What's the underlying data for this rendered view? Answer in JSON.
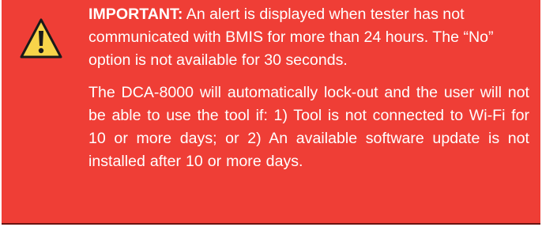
{
  "alert": {
    "icon": "warning-triangle-icon",
    "background_color": "#ef3e36",
    "text_color": "#ffffff",
    "lead": "IMPORTANT:",
    "paragraph1": "An alert is displayed when tester has not communicated with BMIS for more than 24 hours. The “No” option is not available for 30 seconds.",
    "paragraph2": "The DCA-8000 will automatically lock-out and the user will not be able to use the tool if: 1) Tool is not connected to Wi-Fi for 10 or more days; or 2) An available software update is not installed after 10 or more days."
  }
}
